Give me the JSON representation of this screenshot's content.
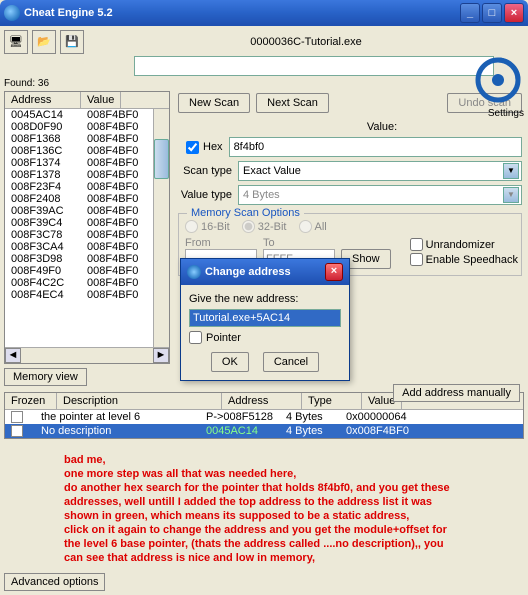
{
  "window": {
    "title": "Cheat Engine 5.2"
  },
  "process": "0000036C-Tutorial.exe",
  "found": "Found: 36",
  "settings": "Settings",
  "addr_hdr": {
    "a": "Address",
    "v": "Value"
  },
  "addresses": [
    [
      "0045AC14",
      "008F4BF0"
    ],
    [
      "008D0F90",
      "008F4BF0"
    ],
    [
      "008F1368",
      "008F4BF0"
    ],
    [
      "008F136C",
      "008F4BF0"
    ],
    [
      "008F1374",
      "008F4BF0"
    ],
    [
      "008F1378",
      "008F4BF0"
    ],
    [
      "008F23F4",
      "008F4BF0"
    ],
    [
      "008F2408",
      "008F4BF0"
    ],
    [
      "008F39AC",
      "008F4BF0"
    ],
    [
      "008F39C4",
      "008F4BF0"
    ],
    [
      "008F3C78",
      "008F4BF0"
    ],
    [
      "008F3CA4",
      "008F4BF0"
    ],
    [
      "008F3D98",
      "008F4BF0"
    ],
    [
      "008F49F0",
      "008F4BF0"
    ],
    [
      "008F4C2C",
      "008F4BF0"
    ],
    [
      "008F4EC4",
      "008F4BF0"
    ]
  ],
  "buttons": {
    "new": "New Scan",
    "next": "Next Scan",
    "undo": "Undo scan",
    "memview": "Memory view",
    "addman": "Add address manually"
  },
  "scan": {
    "value_label": "Value:",
    "hex": "Hex",
    "value": "8f4bf0",
    "scantype_label": "Scan type",
    "scantype": "Exact Value",
    "valuetype_label": "Value type",
    "valuetype": "4 Bytes"
  },
  "memopts": {
    "legend": "Memory Scan Options",
    "r16": "16-Bit",
    "r32": "32-Bit",
    "rall": "All",
    "from": "From",
    "to": "To",
    "fromv": "",
    "tov": "FFFF",
    "show": "Show"
  },
  "checks": {
    "unr": "Unrandomizer",
    "spd": "Enable Speedhack"
  },
  "table": {
    "hdr": {
      "frozen": "Frozen",
      "desc": "Description",
      "addr": "Address",
      "type": "Type",
      "val": "Value"
    },
    "rows": [
      {
        "desc": "the pointer at level 6",
        "addr": "P->008F5128",
        "type": "4 Bytes",
        "val": "0x00000064",
        "sel": false
      },
      {
        "desc": "No description",
        "addr": "0045AC14",
        "type": "4 Bytes",
        "val": "0x008F4BF0",
        "sel": true
      }
    ]
  },
  "notes": [
    "bad me,",
    "one more step was all that was needed here,",
    "do another hex search for the pointer that holds 8f4bf0, and you get these addresses,            well untill I added the top address to the address list it was shown in green, which means its supposed to be a static address,",
    "click on it again to change the address and you get the module+offset for the level 6 base pointer, (thats the address called ....no description),, you can see that address is nice and low in memory,"
  ],
  "advopt": "Advanced options",
  "modal": {
    "title": "Change address",
    "label": "Give the new address:",
    "value": "Tutorial.exe+5AC14",
    "pointer": "Pointer",
    "ok": "OK",
    "cancel": "Cancel"
  }
}
